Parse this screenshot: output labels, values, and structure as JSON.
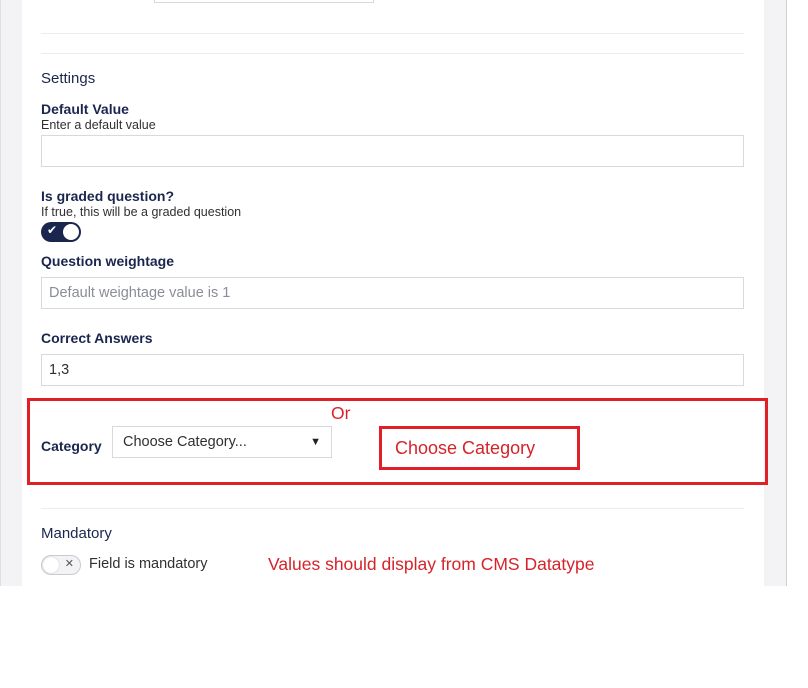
{
  "settings": {
    "section_title": "Settings",
    "default_value": {
      "label": "Default Value",
      "description": "Enter a default value",
      "value": ""
    },
    "graded": {
      "label": "Is graded question?",
      "description": "If true, this will be a graded question",
      "toggle_state": "on"
    },
    "weightage": {
      "label": "Question weightage",
      "placeholder": "Default weightage value is 1"
    },
    "correct_answers": {
      "label": "Correct Answers",
      "value": "1,3"
    },
    "category": {
      "label": "Category",
      "selected": "Choose Category..."
    },
    "mandatory": {
      "section_title": "Mandatory",
      "toggle_label": "Field is mandatory",
      "toggle_state": "off"
    }
  },
  "annotations": {
    "or_text": "Or",
    "choose_category_text": "Choose Category",
    "note_text": "Values should display from CMS Datatype",
    "color": "#d5232a"
  },
  "icons": {
    "toggle_on_icon": "check-icon",
    "toggle_off_icon": "x-icon",
    "select_icon": "chevron-down-icon"
  }
}
